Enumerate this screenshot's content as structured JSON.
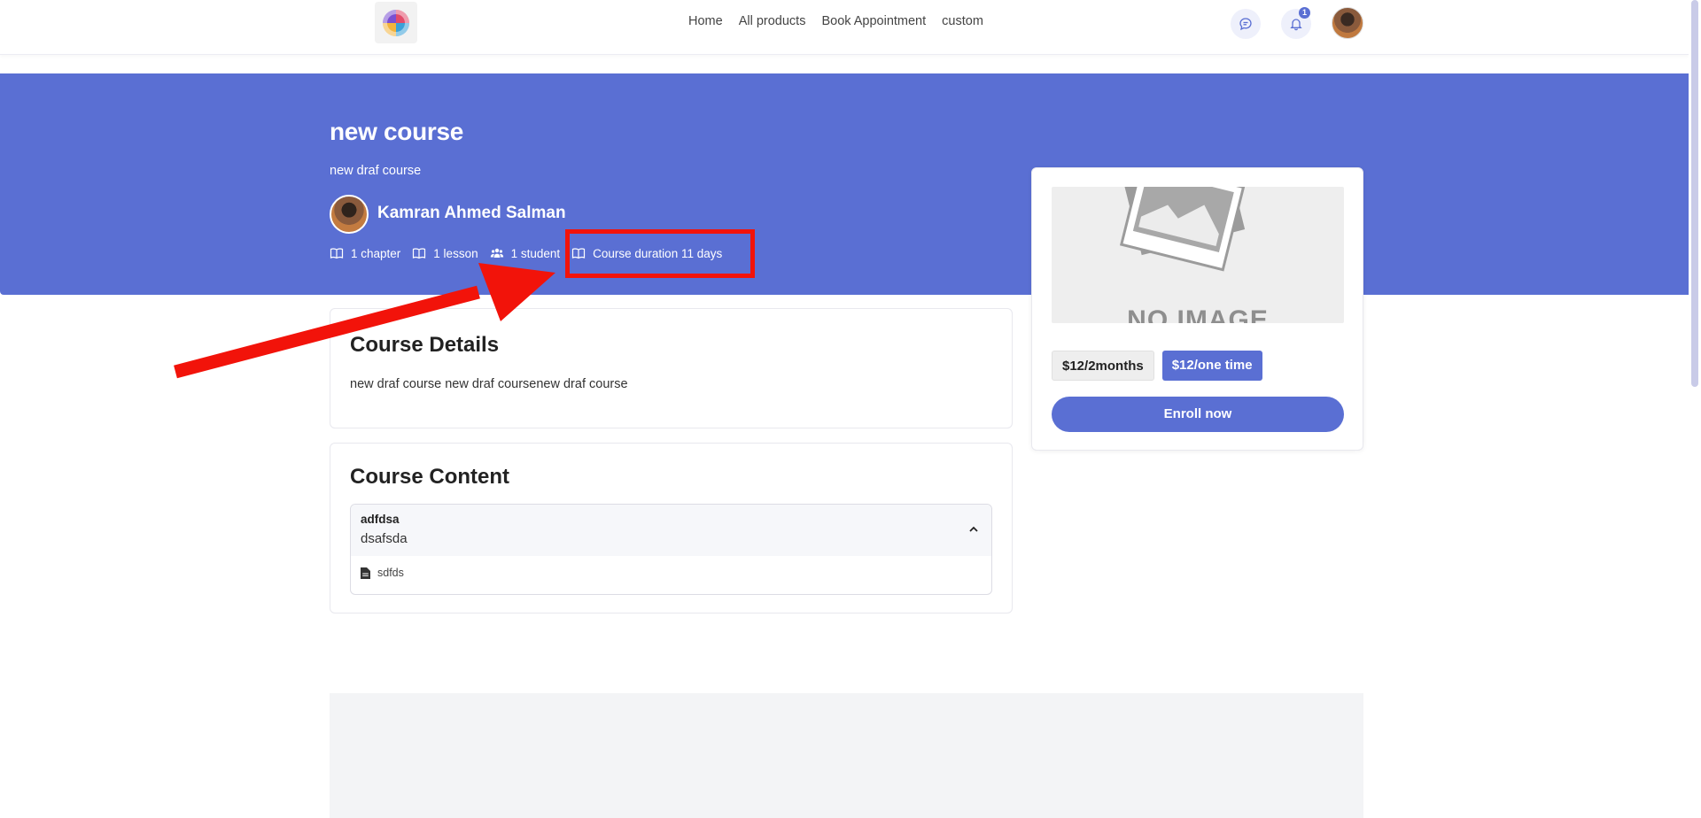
{
  "nav": {
    "links": [
      "Home",
      "All products",
      "Book Appointment",
      "custom"
    ],
    "notification_count": "1"
  },
  "hero": {
    "title": "new course",
    "subtitle": "new draf course",
    "author": "Kamran Ahmed Salman",
    "meta": {
      "chapters": "1 chapter",
      "lessons": "1 lesson",
      "students": "1 student",
      "duration": "Course duration 11 days"
    }
  },
  "details": {
    "title": "Course Details",
    "text": "new draf course new draf coursenew draf course"
  },
  "content": {
    "title": "Course Content",
    "chapter_title": "adfdsa",
    "chapter_subtitle": "dsafsda",
    "lesson": "sdfds"
  },
  "enroll": {
    "image_placeholder": "NO IMAGE",
    "price_options": [
      "$12/2months",
      "$12/one time"
    ],
    "selected_price_index": 1,
    "button_label": "Enroll now"
  },
  "colors": {
    "primary": "#5a6fd3",
    "annotation": "#f2130a"
  },
  "icons": {
    "chat": "chat-icon",
    "bell": "bell-icon",
    "book": "book-icon",
    "users": "users-icon",
    "chevron": "chevron-up-icon",
    "file": "file-icon"
  }
}
